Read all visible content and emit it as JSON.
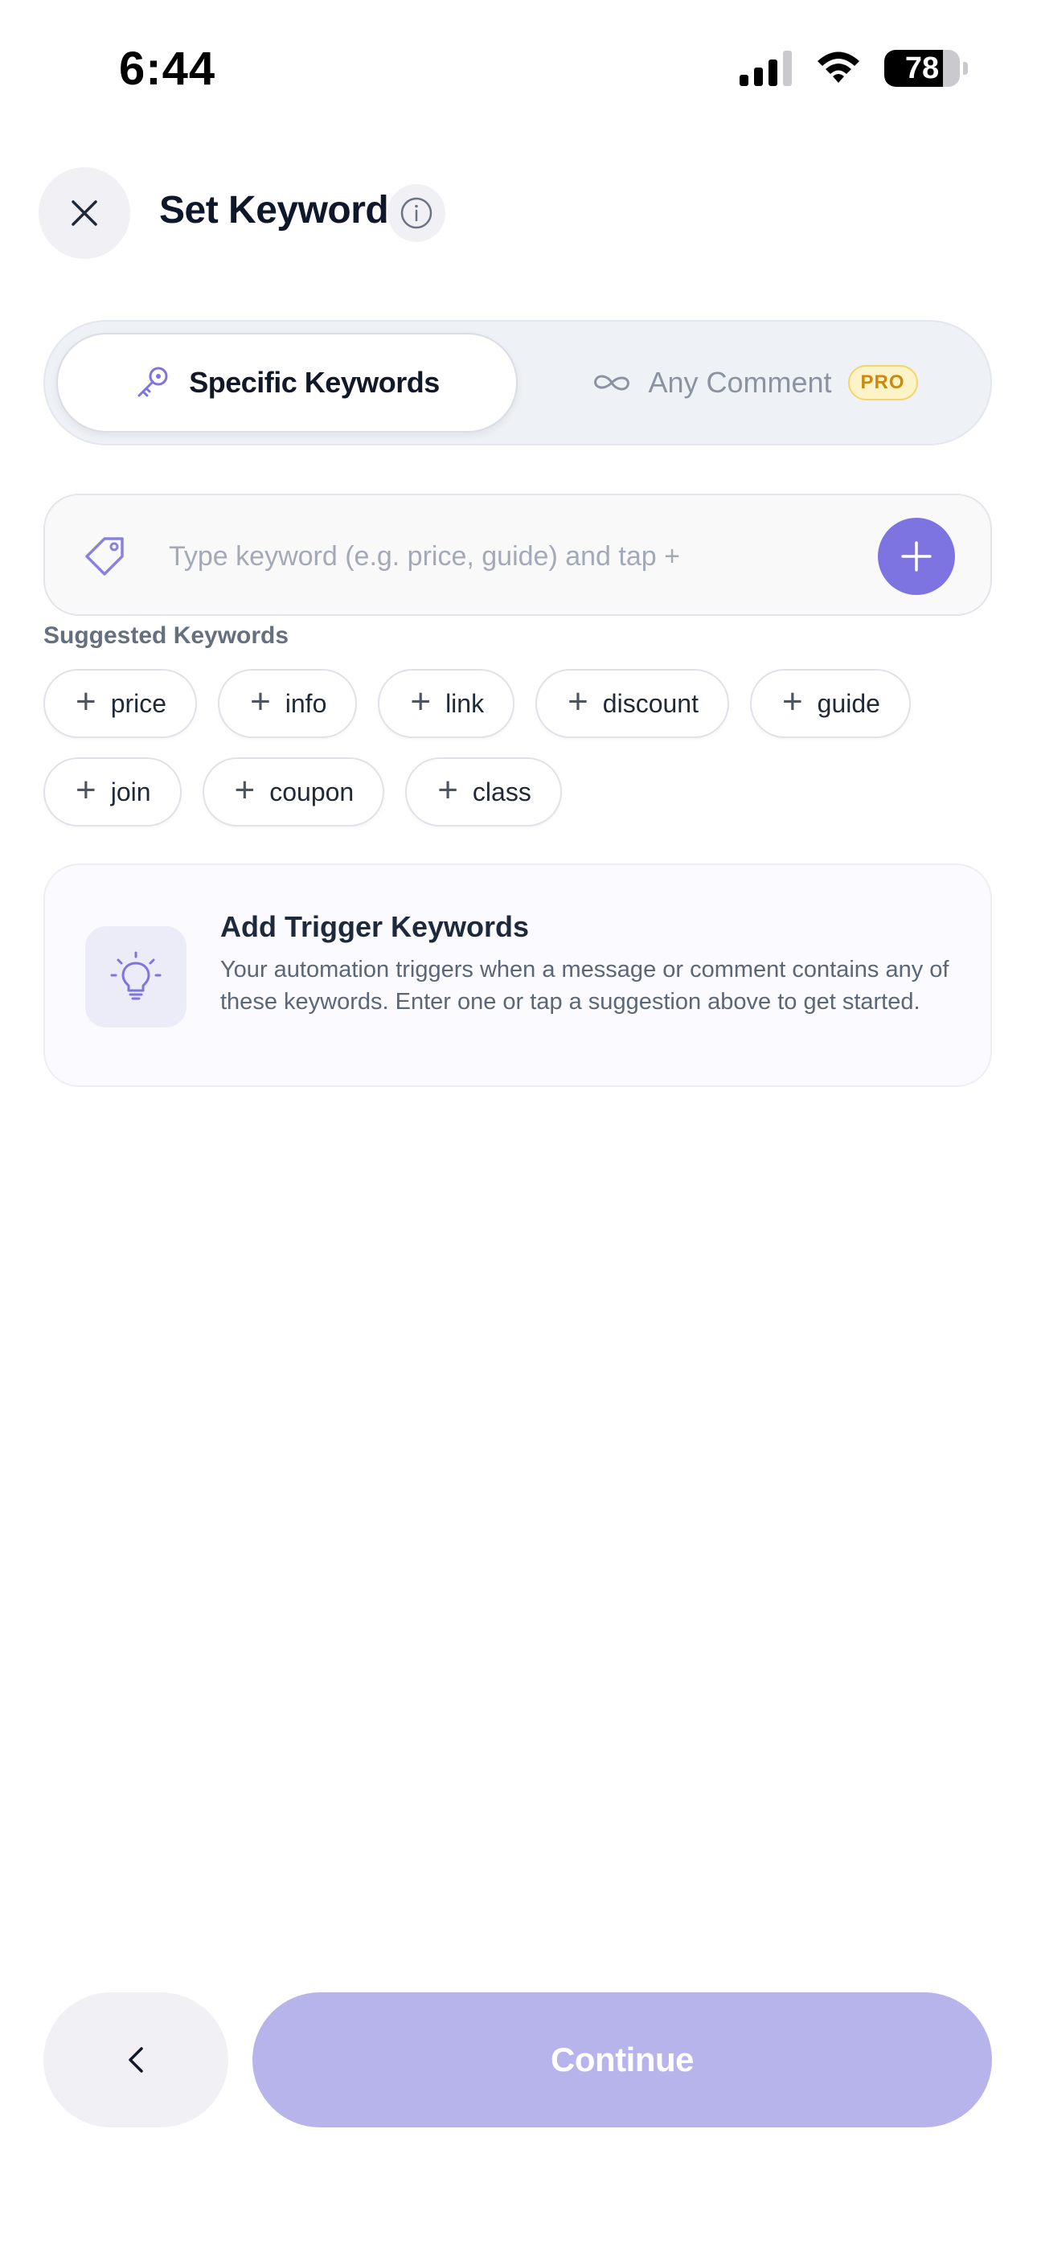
{
  "status_bar": {
    "time": "6:44",
    "battery": "78",
    "battery_level": 0.78
  },
  "header": {
    "title": "Set Keywords",
    "close_icon": "close-icon",
    "info_icon": "info-icon"
  },
  "mode_toggle": {
    "active": {
      "label": "Specific Keywords",
      "icon": "key-icon"
    },
    "other": {
      "label": "Any Comment",
      "icon": "infinity-icon",
      "badge": "PRO"
    }
  },
  "keyword_input": {
    "placeholder": "Type keyword (e.g. price, guide) and tap +",
    "value": ""
  },
  "suggestions": {
    "title": "Suggested Keywords",
    "row1": [
      "price",
      "info",
      "link",
      "discount",
      "guide"
    ],
    "row2": [
      "join",
      "coupon",
      "class"
    ]
  },
  "info_card": {
    "title": "Add Trigger Keywords",
    "body": "Your automation triggers when a message or comment contains any of these keywords. Enter one or tap a suggestion above to get started.",
    "icon": "lightbulb-icon"
  },
  "footer": {
    "continue_label": "Continue",
    "back_icon": "chevron-left-icon"
  },
  "colors": {
    "accent": "#7d74e2",
    "continue_disabled": "#b7b3eb",
    "pro_badge": "#c98a12"
  }
}
